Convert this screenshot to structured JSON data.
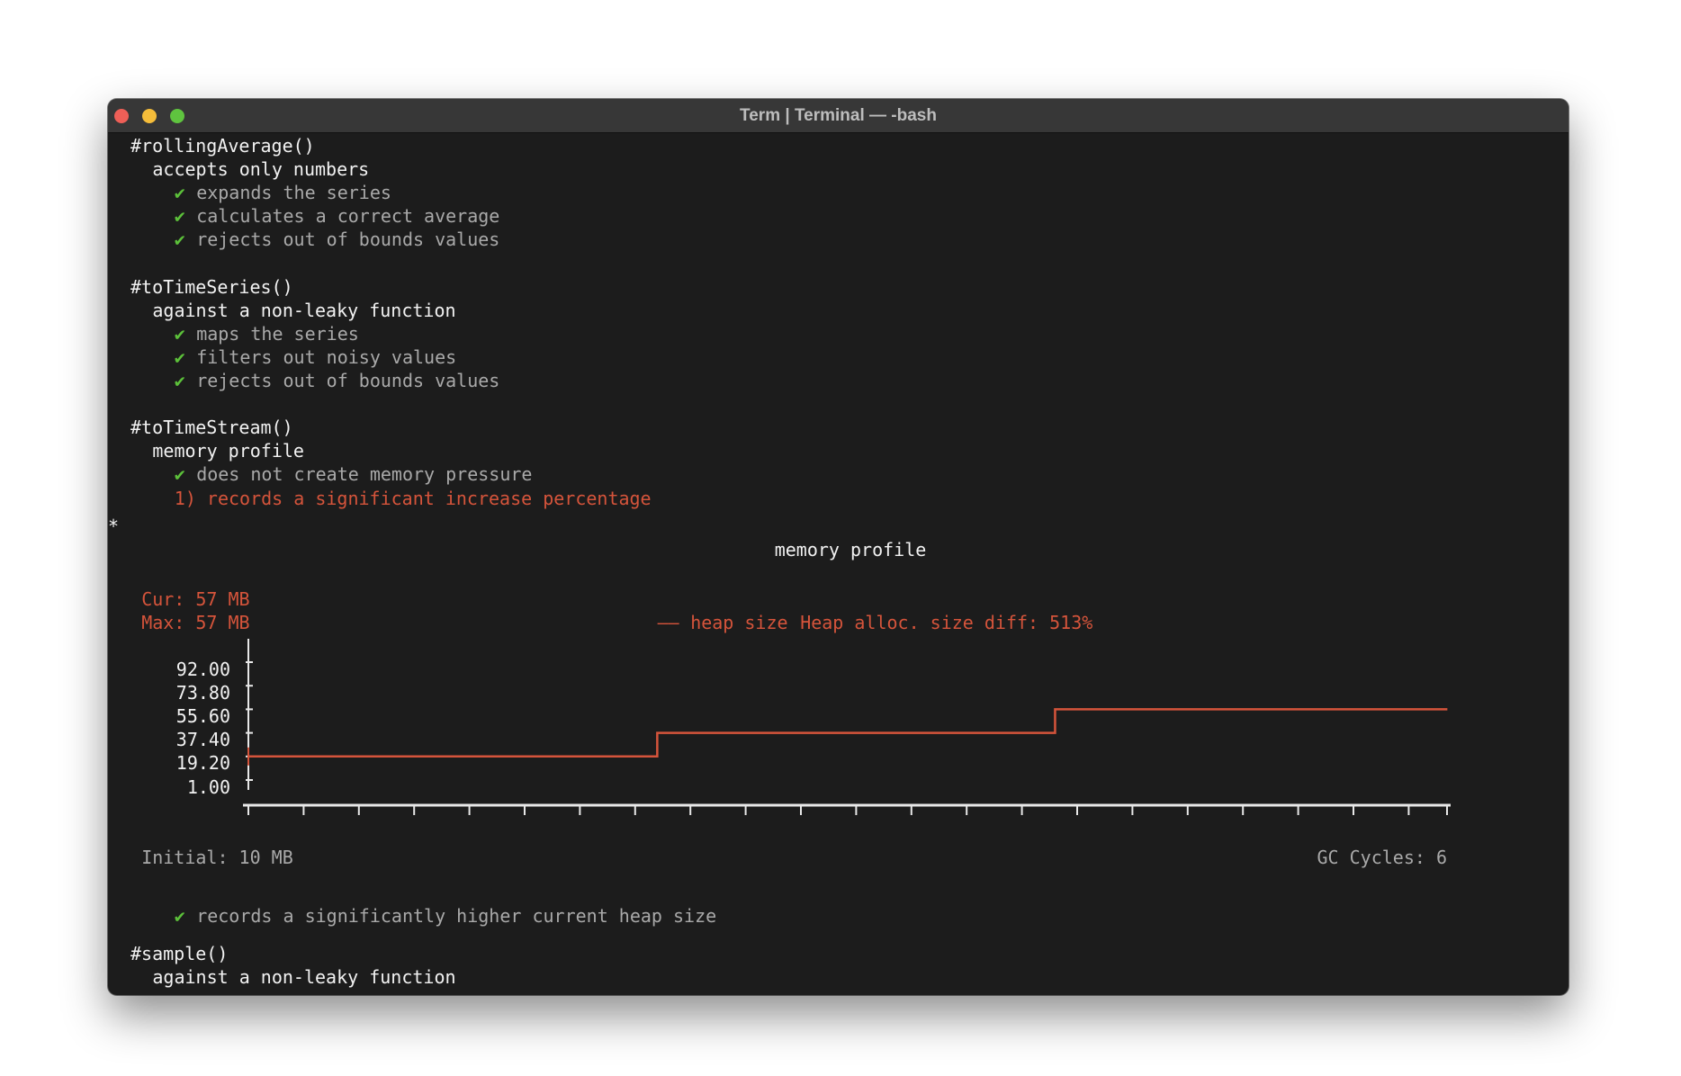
{
  "window": {
    "title": "Term | Terminal — -bash",
    "traffic_lights": {
      "close": "#ee5f57",
      "minimize": "#f5bd3a",
      "zoom": "#5fc43f"
    }
  },
  "colors": {
    "background": "#1c1c1c",
    "pass": "#5cc13a",
    "fail": "#d5543b",
    "muted": "#a9a9a9",
    "heading": "#f2f2f2"
  },
  "output": {
    "suites": [
      {
        "name": "#rollingAverage()",
        "context": "accepts only numbers",
        "tests": [
          {
            "status": "pass",
            "icon": "✔",
            "label": "expands the series"
          },
          {
            "status": "pass",
            "icon": "✔",
            "label": "calculates a correct average"
          },
          {
            "status": "pass",
            "icon": "✔",
            "label": "rejects out of bounds values"
          }
        ]
      },
      {
        "name": "#toTimeSeries()",
        "context": "against a non-leaky function",
        "tests": [
          {
            "status": "pass",
            "icon": "✔",
            "label": "maps the series"
          },
          {
            "status": "pass",
            "icon": "✔",
            "label": "filters out noisy values"
          },
          {
            "status": "pass",
            "icon": "✔",
            "label": "rejects out of bounds values"
          }
        ]
      },
      {
        "name": "#toTimeStream()",
        "context": "memory profile",
        "tests": [
          {
            "status": "pass",
            "icon": "✔",
            "label": "does not create memory pressure"
          },
          {
            "status": "fail",
            "icon": "",
            "label": "1) records a significant increase percentage"
          }
        ]
      }
    ],
    "asterisk": "*",
    "after_chart_test": {
      "status": "pass",
      "icon": "✔",
      "label": "records a significantly higher current heap size"
    },
    "next_suite": {
      "name": "#sample()",
      "context": "against a non-leaky function"
    }
  },
  "chart_data": {
    "type": "line",
    "title": "memory profile",
    "stats": {
      "current": "Cur: 57 MB",
      "max": "Max: 57 MB",
      "initial": "Initial: 10 MB",
      "gc_cycles": "GC Cycles: 6"
    },
    "legend": {
      "marker": "——",
      "label": "heap size",
      "position": "top-center"
    },
    "annotation": "Heap alloc. size diff: 513%",
    "y_ticks": [
      "92.00",
      "73.80",
      "55.60",
      "37.40",
      "19.20",
      "1.00"
    ],
    "ylim": [
      1.0,
      92.0
    ],
    "x_tick_count": 22,
    "series": [
      {
        "name": "heap size",
        "color": "#d5543b",
        "step": true,
        "x": [
          0,
          7.4,
          7.4,
          14.6,
          14.6,
          21.7
        ],
        "y": [
          19.2,
          19.2,
          37.4,
          37.4,
          55.6,
          55.6
        ]
      }
    ],
    "grid": false
  }
}
